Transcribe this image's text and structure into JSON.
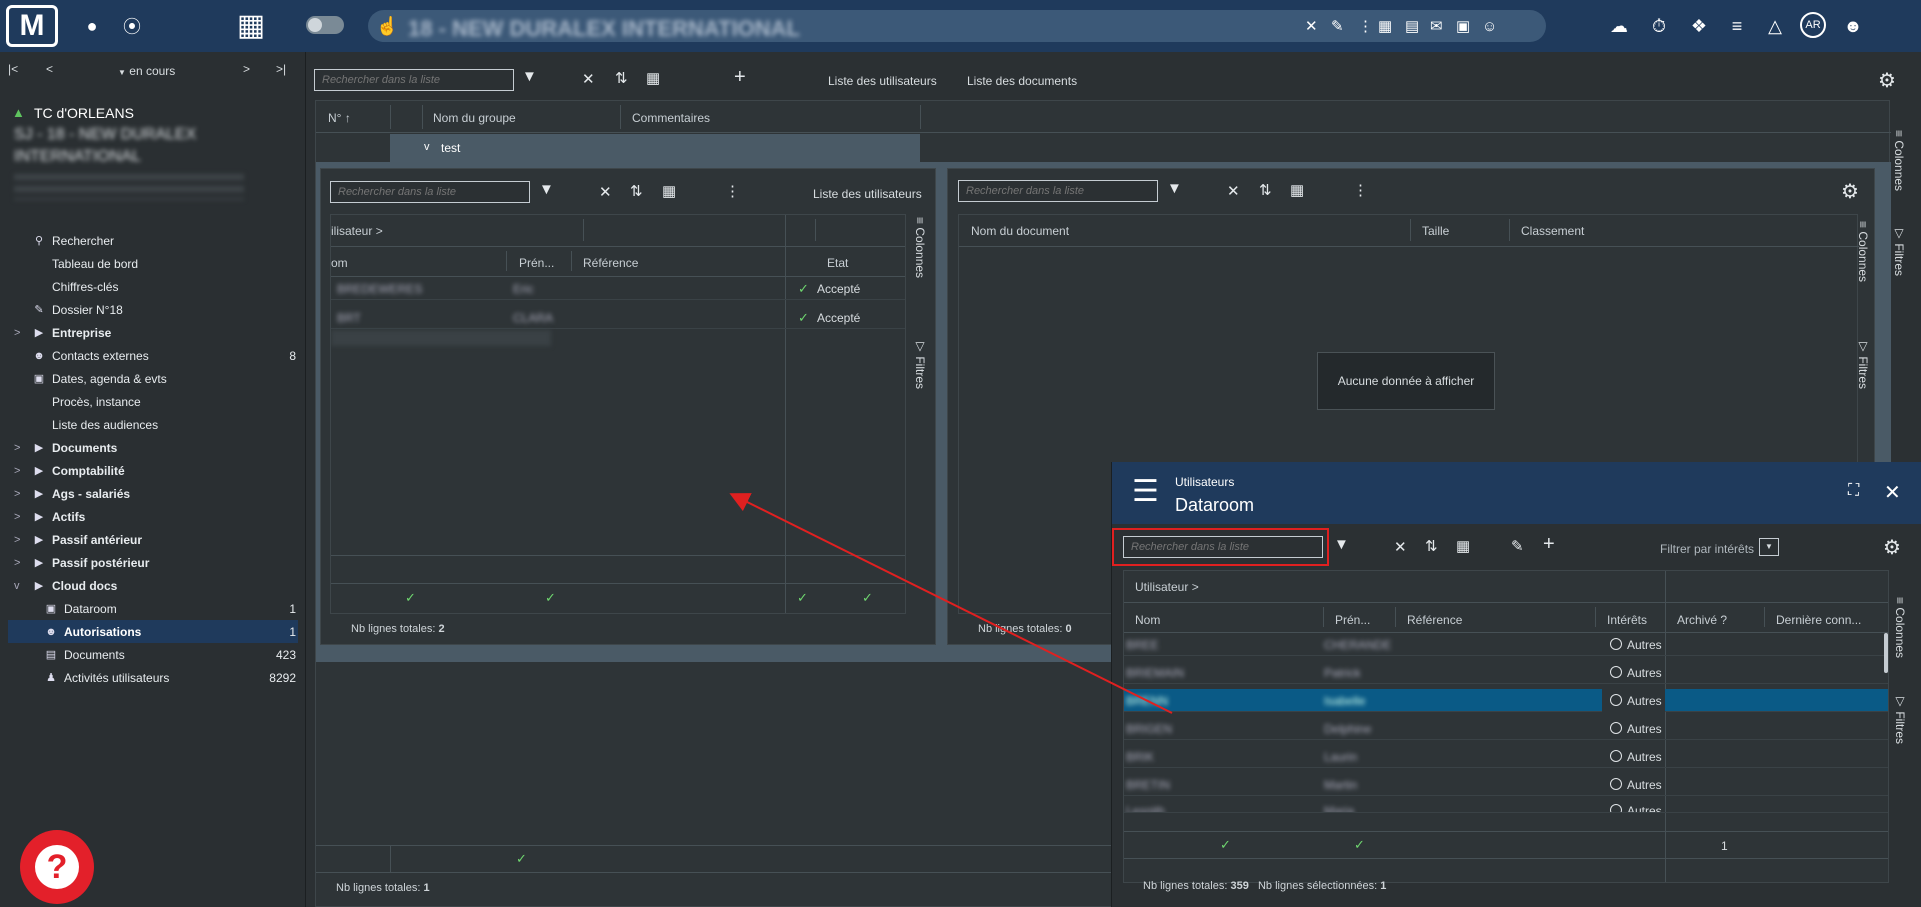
{
  "topbar": {
    "title": "18 - NEW DURALEX INTERNATIONAL",
    "avatar_initials": "AR"
  },
  "sidebar": {
    "nav_label": "en cours",
    "org_name": "TC d'ORLEANS",
    "case_title": "SJ - 18 - NEW DURALEX INTERNATIONAL",
    "items": [
      {
        "label": "Rechercher",
        "count": ""
      },
      {
        "label": "Tableau de bord",
        "count": ""
      },
      {
        "label": "Chiffres-clés",
        "count": ""
      },
      {
        "label": "Dossier N°18",
        "count": ""
      },
      {
        "label": "Entreprise",
        "count": ""
      },
      {
        "label": "Contacts externes",
        "count": "8"
      },
      {
        "label": "Dates, agenda & evts",
        "count": ""
      },
      {
        "label": "Procès, instance",
        "count": ""
      },
      {
        "label": "Liste des audiences",
        "count": ""
      },
      {
        "label": "Documents",
        "count": ""
      },
      {
        "label": "Comptabilité",
        "count": ""
      },
      {
        "label": "Ags - salariés",
        "count": ""
      },
      {
        "label": "Actifs",
        "count": ""
      },
      {
        "label": "Passif antérieur",
        "count": ""
      },
      {
        "label": "Passif postérieur",
        "count": ""
      },
      {
        "label": "Cloud docs",
        "count": ""
      },
      {
        "label": "Dataroom",
        "count": "1"
      },
      {
        "label": "Autorisations",
        "count": "1"
      },
      {
        "label": "Documents",
        "count": "423"
      },
      {
        "label": "Activités utilisateurs",
        "count": "8292"
      }
    ]
  },
  "main": {
    "search_placeholder": "Rechercher dans la liste",
    "link_users": "Liste des utilisateurs",
    "link_docs": "Liste des documents",
    "col_num": "N°",
    "col_group": "Nom du groupe",
    "col_comments": "Commentaires",
    "group_name": "test",
    "total_label": "Nb lignes totales:",
    "total_value": "1",
    "footer_check": "✓",
    "colonnes": "Colonnes",
    "filtres": "Filtres"
  },
  "users_panel": {
    "search_placeholder": "Rechercher dans la liste",
    "title": "Liste des utilisateurs",
    "group_header": "ilisateur",
    "col_nom": "om",
    "col_prenom": "Prén...",
    "col_ref": "Référence",
    "col_etat": "Etat",
    "rows": [
      {
        "nom": "BREDEWERES",
        "prenom": "Eric",
        "etat": "Accepté"
      },
      {
        "nom": "BRT",
        "prenom": "CLARA",
        "etat": "Accepté"
      }
    ],
    "total_label": "Nb lignes totales:",
    "total_value": "2"
  },
  "docs_panel": {
    "search_placeholder": "Rechercher dans la liste",
    "col_doc": "Nom du document",
    "col_size": "Taille",
    "col_class": "Classement",
    "empty": "Aucune donnée à afficher",
    "total_label": "Nb lignes totales:",
    "total_value": "0"
  },
  "dataroom": {
    "subtitle": "Utilisateurs",
    "title": "Dataroom",
    "search_placeholder": "Rechercher dans la liste",
    "filter_label": "Filtrer par intérêts",
    "group_header": "Utilisateur",
    "col_nom": "Nom",
    "col_prenom": "Prén...",
    "col_ref": "Référence",
    "col_interets": "Intérêts",
    "col_archive": "Archivé ?",
    "col_last": "Dernière conn...",
    "rows": [
      {
        "nom": "BREE",
        "prenom": "CHERANDE",
        "interet": "Autres"
      },
      {
        "nom": "BRIEMAIN",
        "prenom": "Patrick",
        "interet": "Autres"
      },
      {
        "nom": "BRENN",
        "prenom": "Isabelle",
        "interet": "Autres"
      },
      {
        "nom": "BRIGEN",
        "prenom": "Delphine",
        "interet": "Autres"
      },
      {
        "nom": "BRIK",
        "prenom": "Laurin",
        "interet": "Autres"
      },
      {
        "nom": "BRETIN",
        "prenom": "Martin",
        "interet": "Autres"
      },
      {
        "nom": "Lesnith",
        "prenom": "Maria",
        "interet": "Autres"
      }
    ],
    "footer_archive": "1",
    "total_label": "Nb lignes totales:",
    "total_value": "359",
    "selected_label": "Nb lignes sélectionnées:",
    "selected_value": "1",
    "colonnes": "Colonnes",
    "filtres": "Filtres"
  },
  "colors": {
    "accent": "#1f3a5c",
    "selected_row": "#0a5a86",
    "highlight_box": "#e02020",
    "arrow": "#e02020",
    "check": "#6fd66f"
  }
}
